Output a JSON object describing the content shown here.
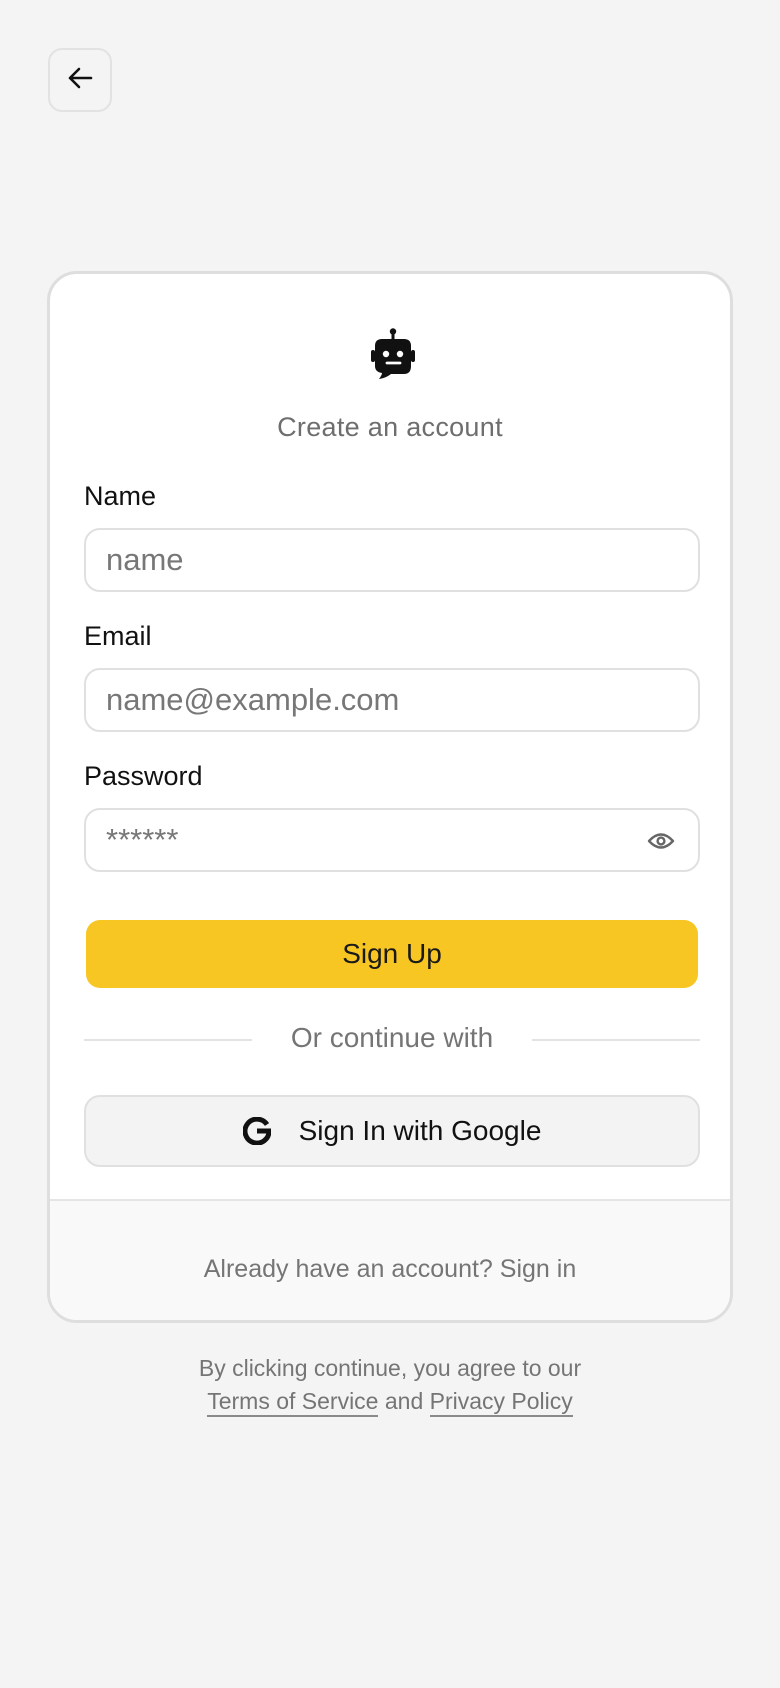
{
  "back_button": {
    "icon": "arrow-left-icon"
  },
  "card": {
    "logo_icon": "robot-logo-icon",
    "title": "Create an account",
    "name": {
      "label": "Name",
      "placeholder": "name"
    },
    "email": {
      "label": "Email",
      "placeholder": "name@example.com"
    },
    "password": {
      "label": "Password",
      "placeholder": "******",
      "toggle_icon": "eye-icon"
    },
    "signup_label": "Sign Up",
    "divider_text": "Or continue with",
    "google": {
      "icon": "google-icon",
      "label": "Sign In with Google"
    },
    "footer": {
      "prompt": "Already have an account?",
      "link": "Sign in"
    }
  },
  "legal": {
    "line1": "By clicking continue, you agree to our",
    "terms": "Terms of Service",
    "and": "and",
    "privacy": "Privacy Policy"
  },
  "colors": {
    "accent": "#f8c623",
    "background": "#f4f4f4",
    "card": "#ffffff",
    "muted_text": "#757575"
  }
}
